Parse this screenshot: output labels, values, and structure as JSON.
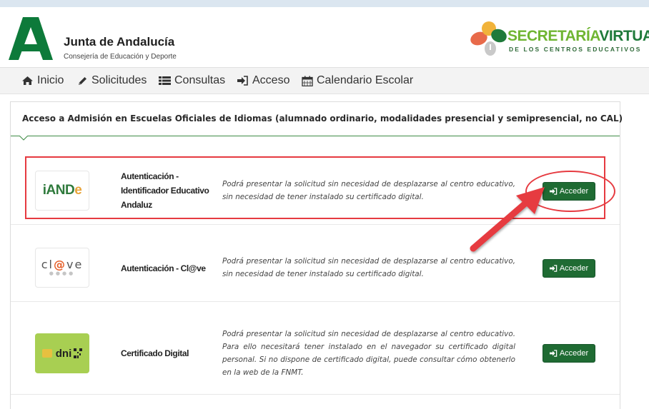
{
  "header": {
    "org_title": "Junta de Andalucía",
    "org_subtitle": "Consejería de Educación y Deporte",
    "brand_part1": "SECRETARÍA",
    "brand_part2": "VIRTUAL",
    "brand_subtitle": "DE LOS CENTROS EDUCATIVOS"
  },
  "nav": {
    "items": [
      {
        "label": "Inicio",
        "icon": "home-icon"
      },
      {
        "label": "Solicitudes",
        "icon": "pencil-icon"
      },
      {
        "label": "Consultas",
        "icon": "list-icon"
      },
      {
        "label": "Acceso",
        "icon": "sign-in-icon"
      },
      {
        "label": "Calendario Escolar",
        "icon": "calendar-icon"
      }
    ]
  },
  "panel": {
    "title": "Acceso a Admisión en Escuelas Oficiales de Idiomas (alumnado ordinario, modalidades presencial y semipresencial, no CAL)"
  },
  "methods": [
    {
      "logo_part1": "iAND",
      "logo_part2": "e",
      "name_lines": [
        "Autenticación -",
        "Identificador Educativo",
        "Andaluz"
      ],
      "description": "Podrá presentar la solicitud sin necesidad de desplazarse al centro educativo, sin necesidad de tener instalado su certificado digital.",
      "button_label": "Acceder"
    },
    {
      "logo_part1": "cl",
      "logo_part2": "@",
      "logo_part3": "ve",
      "name": "Autenticación - Cl@ve",
      "description": "Podrá presentar la solicitud sin necesidad de desplazarse al centro educativo, sin necesidad de tener instalado su certificado digital.",
      "button_label": "Acceder"
    },
    {
      "logo_text": "dni",
      "name": "Certificado Digital",
      "description": "Podrá presentar la solicitud sin necesidad de desplazarse al centro educativo. Para ello necesitará tener instalado en el navegador su certificado digital personal. Si no dispone de certificado digital, puede consultar cómo obtenerlo en la web de la FNMT.",
      "button_label": "Acceder"
    }
  ],
  "colors": {
    "accent_green": "#1f6b33",
    "highlight_red": "#e63a40",
    "nav_bg": "#f3f3f3"
  }
}
